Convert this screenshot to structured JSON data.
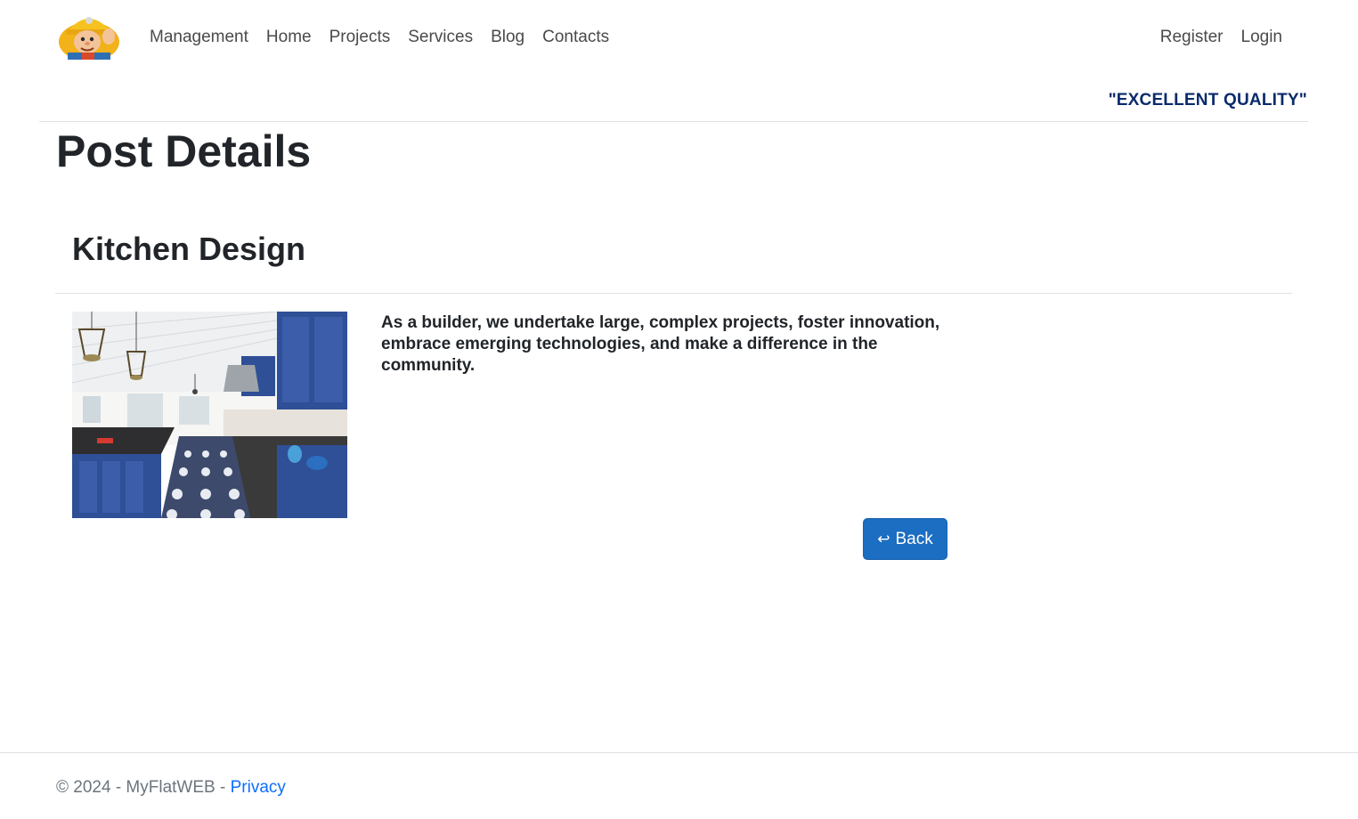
{
  "navbar": {
    "logo_icon": "builder-mascot-icon",
    "left_links": [
      "Management",
      "Home",
      "Projects",
      "Services",
      "Blog",
      "Contacts"
    ],
    "right_links": [
      "Register",
      "Login"
    ]
  },
  "tagline": "\"EXCELLENT QUALITY\"",
  "page_title": "Post Details",
  "post": {
    "title": "Kitchen Design",
    "image_icon": "kitchen-photo",
    "text": "As a builder, we undertake large, complex projects, foster innovation, embrace emerging technologies, and make a difference in the community.",
    "back_icon": "return-arrow-icon",
    "back_glyph": "↩",
    "back_label": "Back"
  },
  "footer": {
    "copyright": "© 2024 - MyFlatWEB - ",
    "privacy_label": "Privacy"
  },
  "colors": {
    "primary_button": "#1b6ec2",
    "tagline": "#0a2a6b",
    "link": "#0d6efd"
  }
}
